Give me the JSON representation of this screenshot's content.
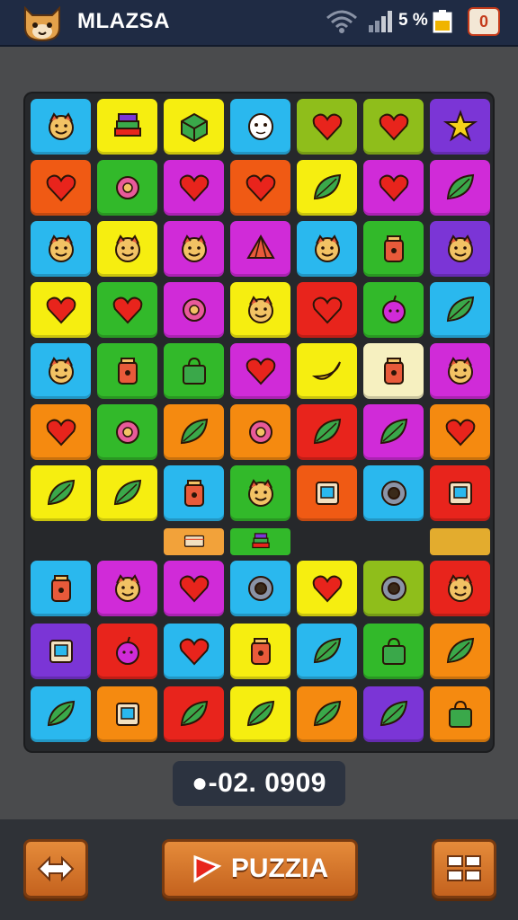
{
  "header": {
    "title": "MLAZSA",
    "battery_label": "5 %",
    "menu_glyph": "0"
  },
  "colors": {
    "topbar": "#1f2b44",
    "board": "#26282b",
    "button": "#d9762c"
  },
  "board": {
    "rows": [
      [
        {
          "c": "#2ab8ee",
          "i": "face"
        },
        {
          "c": "#f6ee10",
          "i": "book"
        },
        {
          "c": "#f6ee10",
          "i": "cube"
        },
        {
          "c": "#2ab8ee",
          "i": "ghost"
        },
        {
          "c": "#8fbe1b",
          "i": "heart"
        },
        {
          "c": "#8fbe1b",
          "i": "heart"
        },
        {
          "c": "#7b35d6",
          "i": "star"
        }
      ],
      [
        {
          "c": "#f05a14",
          "i": "heart"
        },
        {
          "c": "#32b92a",
          "i": "flower"
        },
        {
          "c": "#d02bd8",
          "i": "heart"
        },
        {
          "c": "#f05a14",
          "i": "heart"
        },
        {
          "c": "#f6ee10",
          "i": "leaf"
        },
        {
          "c": "#d02bd8",
          "i": "heart"
        },
        {
          "c": "#d02bd8",
          "i": "leaf"
        }
      ],
      [
        {
          "c": "#2ab8ee",
          "i": "face"
        },
        {
          "c": "#f6ee10",
          "i": "face"
        },
        {
          "c": "#d02bd8",
          "i": "face"
        },
        {
          "c": "#d02bd8",
          "i": "fan"
        },
        {
          "c": "#2ab8ee",
          "i": "face"
        },
        {
          "c": "#32b92a",
          "i": "jar"
        },
        {
          "c": "#7b35d6",
          "i": "face"
        }
      ],
      [
        {
          "c": "#f6ee10",
          "i": "heart"
        },
        {
          "c": "#32b92a",
          "i": "heart"
        },
        {
          "c": "#d02bd8",
          "i": "flower"
        },
        {
          "c": "#f6ee10",
          "i": "face"
        },
        {
          "c": "#e8241c",
          "i": "heart"
        },
        {
          "c": "#32b92a",
          "i": "apple"
        },
        {
          "c": "#2ab8ee",
          "i": "leaf"
        }
      ],
      [
        {
          "c": "#2ab8ee",
          "i": "face"
        },
        {
          "c": "#32b92a",
          "i": "jar"
        },
        {
          "c": "#32b92a",
          "i": "bag"
        },
        {
          "c": "#d02bd8",
          "i": "heart"
        },
        {
          "c": "#f6ee10",
          "i": "banana"
        },
        {
          "c": "#f6f0c0",
          "i": "jar"
        },
        {
          "c": "#d02bd8",
          "i": "face"
        }
      ],
      [
        {
          "c": "#f58a10",
          "i": "heart"
        },
        {
          "c": "#32b92a",
          "i": "flower"
        },
        {
          "c": "#f58a10",
          "i": "leaf"
        },
        {
          "c": "#f58a10",
          "i": "flower"
        },
        {
          "c": "#e8241c",
          "i": "leaf"
        },
        {
          "c": "#d02bd8",
          "i": "leaf"
        },
        {
          "c": "#f58a10",
          "i": "heart"
        }
      ],
      [
        {
          "c": "#f6ee10",
          "i": "leaf"
        },
        {
          "c": "#f6ee10",
          "i": "leaf"
        },
        {
          "c": "#2ab8ee",
          "i": "jar"
        },
        {
          "c": "#32b92a",
          "i": "face"
        },
        {
          "c": "#f05a14",
          "i": "box"
        },
        {
          "c": "#2ab8ee",
          "i": "ring"
        },
        {
          "c": "#e8241c",
          "i": "box"
        }
      ],
      [
        {
          "c": "#2ab8ee",
          "i": "jar"
        },
        {
          "c": "#d02bd8",
          "i": "face"
        },
        {
          "c": "#d02bd8",
          "i": "heart"
        },
        {
          "c": "#2ab8ee",
          "i": "ring"
        },
        {
          "c": "#f6ee10",
          "i": "heart"
        },
        {
          "c": "#8fbe1b",
          "i": "ring"
        },
        {
          "c": "#e8241c",
          "i": "face"
        }
      ],
      [
        {
          "c": "#7b35d6",
          "i": "box"
        },
        {
          "c": "#e8241c",
          "i": "apple"
        },
        {
          "c": "#2ab8ee",
          "i": "heart"
        },
        {
          "c": "#f6ee10",
          "i": "jar"
        },
        {
          "c": "#2ab8ee",
          "i": "leaf"
        },
        {
          "c": "#32b92a",
          "i": "bag"
        },
        {
          "c": "#f58a10",
          "i": "leaf"
        }
      ],
      [
        {
          "c": "#2ab8ee",
          "i": "leaf"
        },
        {
          "c": "#f58a10",
          "i": "box"
        },
        {
          "c": "#e8241c",
          "i": "leaf"
        },
        {
          "c": "#f6ee10",
          "i": "leaf"
        },
        {
          "c": "#f58a10",
          "i": "leaf"
        },
        {
          "c": "#7b35d6",
          "i": "leaf"
        },
        {
          "c": "#f58a10",
          "i": "bag"
        }
      ]
    ],
    "gap_items": [
      {
        "c": "#f2a23a",
        "i": "cake"
      },
      {
        "c": "#32b92a",
        "i": "book"
      },
      {
        "c": "#e3ac2e",
        "i": "blank"
      }
    ]
  },
  "score": {
    "value": "●-02. 0909"
  },
  "footer": {
    "swap_icon": "swap-icon",
    "puzzle_label": "PUZZIA",
    "grid_icon": "grid-icon"
  }
}
